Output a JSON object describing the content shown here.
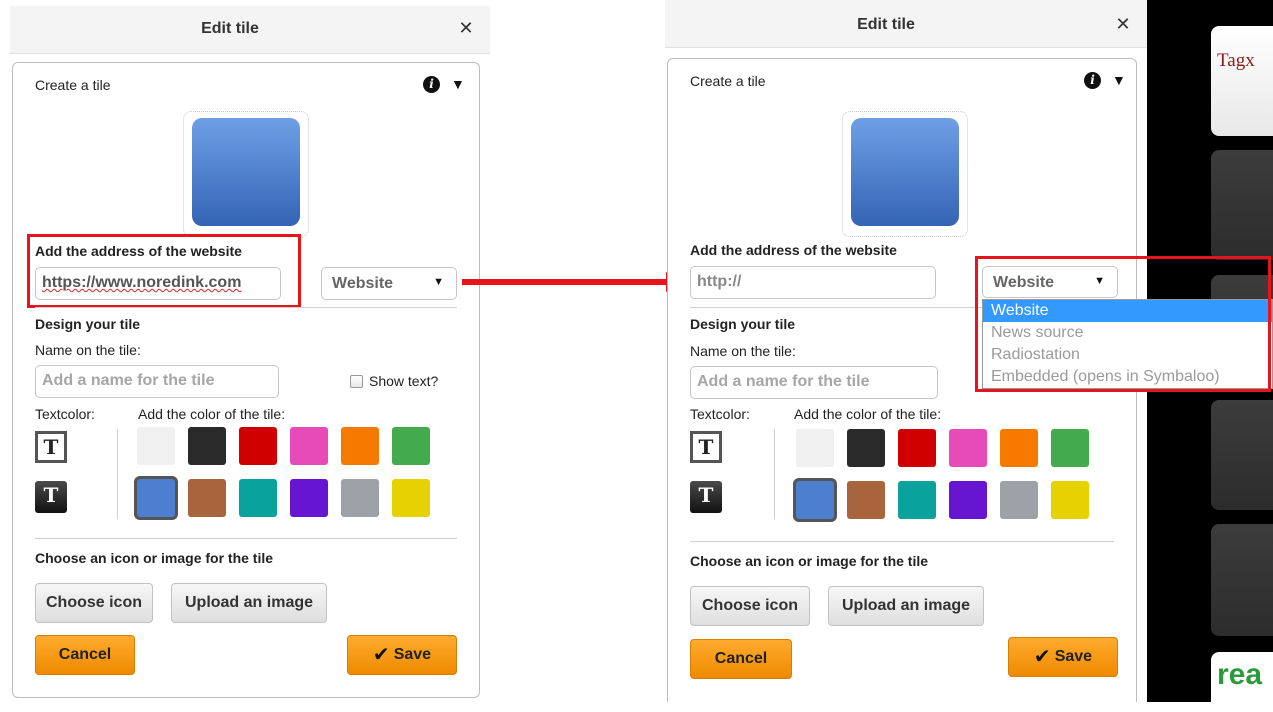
{
  "left_panel": {
    "header_title": "Edit tile",
    "close_glyph": "✕",
    "create_label": "Create a tile",
    "info_glyph": "i",
    "collapse_glyph": "▼",
    "address_label": "Add the address of the website",
    "url_value": "https://www.noredink.com",
    "type_select_value": "Website",
    "select_caret": "▼",
    "design_label": "Design your tile",
    "name_label": "Name on the tile:",
    "name_placeholder": "Add a name for the tile",
    "show_text_label": "Show text?",
    "textcolor_label": "Textcolor:",
    "tile_color_label": "Add the color of the tile:",
    "t_glyph": "T",
    "icon_section_label": "Choose an icon or image for the tile",
    "choose_icon_label": "Choose icon",
    "upload_image_label": "Upload an image",
    "cancel_label": "Cancel",
    "save_label": "Save",
    "check_glyph": "✔"
  },
  "right_panel": {
    "header_title": "Edit tile",
    "close_glyph": "✕",
    "create_label": "Create a tile",
    "info_glyph": "i",
    "collapse_glyph": "▼",
    "address_label": "Add the address of the website",
    "url_value": "http://",
    "type_select_value": "Website",
    "select_caret": "▼",
    "dropdown_options": [
      "Website",
      "News source",
      "Radiostation",
      "Embedded (opens in Symbaloo)"
    ],
    "design_label": "Design your tile",
    "name_label": "Name on the tile:",
    "name_placeholder": "Add a name for the tile",
    "textcolor_label": "Textcolor:",
    "tile_color_label": "Add the color of the tile:",
    "t_glyph": "T",
    "icon_section_label": "Choose an icon or image for the tile",
    "choose_icon_label": "Choose icon",
    "upload_image_label": "Upload an image",
    "cancel_label": "Cancel",
    "save_label": "Save",
    "check_glyph": "✔"
  },
  "tile_colors": [
    {
      "name": "white",
      "color": "#f0f0f0",
      "selected": false
    },
    {
      "name": "black",
      "color": "#2a2a2a",
      "selected": false
    },
    {
      "name": "red",
      "color": "#d00000",
      "selected": false
    },
    {
      "name": "pink",
      "color": "#e64bb7",
      "selected": false
    },
    {
      "name": "orange",
      "color": "#f77a00",
      "selected": false
    },
    {
      "name": "green",
      "color": "#43aa4d",
      "selected": false
    },
    {
      "name": "blue",
      "color": "#4d7fd0",
      "selected": true
    },
    {
      "name": "brown",
      "color": "#a8653d",
      "selected": false
    },
    {
      "name": "teal",
      "color": "#0aa29c",
      "selected": false
    },
    {
      "name": "purple",
      "color": "#6615d0",
      "selected": false
    },
    {
      "name": "gray",
      "color": "#9ea2a8",
      "selected": false
    },
    {
      "name": "yellow",
      "color": "#e6d200",
      "selected": false
    }
  ],
  "annotation_color": "#e8141b",
  "background_tiles": {
    "tile_1_text": "Tagx",
    "tile_6_text": "rea"
  }
}
